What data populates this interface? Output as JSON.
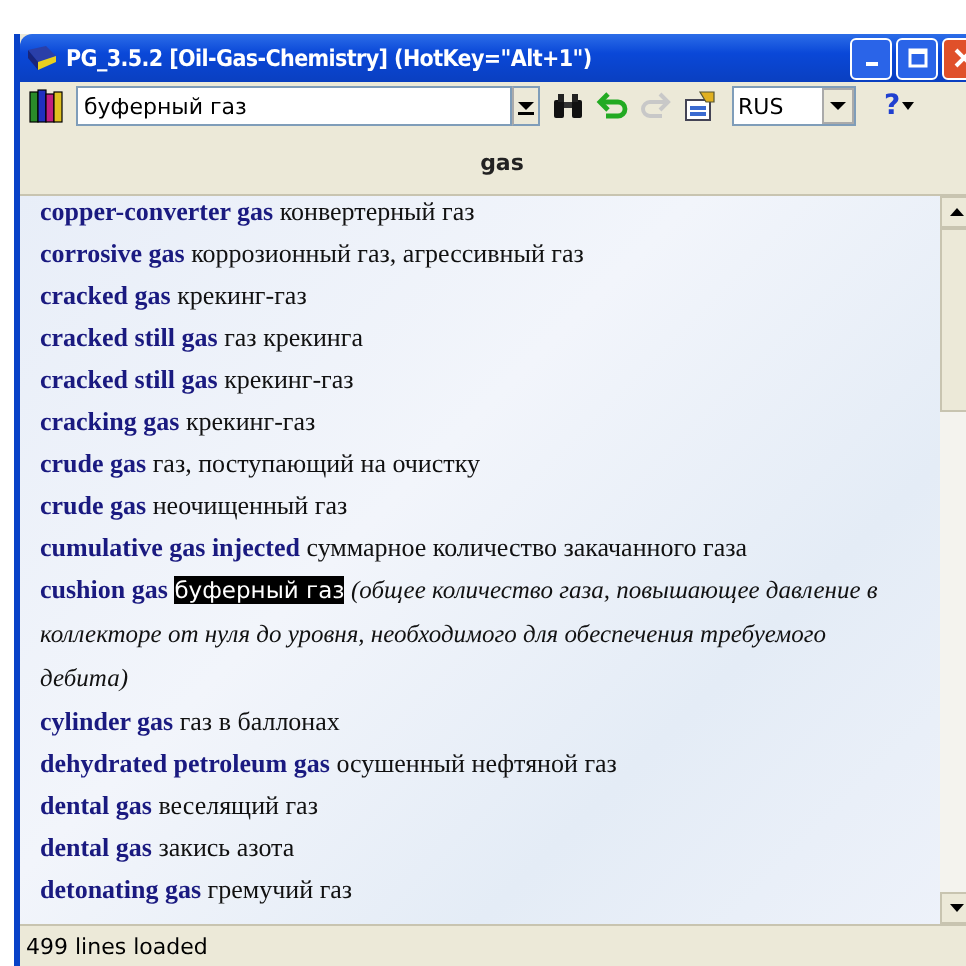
{
  "window": {
    "title": "PG_3.5.2 [Oil-Gas-Chemistry] (HotKey=\"Alt+1\")"
  },
  "toolbar": {
    "search": {
      "value": "буферный газ"
    },
    "forward_disabled": true,
    "language": "RUS",
    "help": "?"
  },
  "header": "gas",
  "entries": [
    {
      "term": "copper-converter gas",
      "translation": "конвертерный газ",
      "selected": false
    },
    {
      "term": "corrosive gas",
      "translation": "коррозионный газ, агрессивный газ",
      "selected": false
    },
    {
      "term": "cracked gas",
      "translation": "крекинг-газ",
      "selected": false
    },
    {
      "term": "cracked still gas",
      "translation": "газ крекинга",
      "selected": false
    },
    {
      "term": "cracked still gas",
      "translation": "крекинг-газ",
      "selected": false
    },
    {
      "term": "cracking gas",
      "translation": "крекинг-газ",
      "selected": false
    },
    {
      "term": "crude gas",
      "translation": "газ, поступающий на очистку",
      "selected": false
    },
    {
      "term": "crude gas",
      "translation": "неочищенный газ",
      "selected": false
    },
    {
      "term": "cumulative gas injected",
      "translation": "суммарное количество закачанного газа",
      "selected": false
    },
    {
      "term": "cushion gas",
      "translation": "буферный газ",
      "note": "(общее количество газа, повышающее давление в коллекторе от нуля до уровня, необходимого для обеспечения требуемого дебита)",
      "selected": true
    },
    {
      "term": "cylinder gas",
      "translation": "газ в баллонах",
      "selected": false
    },
    {
      "term": "dehydrated petroleum gas",
      "translation": "осушенный нефтяной газ",
      "selected": false
    },
    {
      "term": "dental gas",
      "translation": "веселящий газ",
      "selected": false
    },
    {
      "term": "dental gas",
      "translation": "закись азота",
      "selected": false
    },
    {
      "term": "detonating gas",
      "translation": "гремучий газ",
      "selected": false
    }
  ],
  "status_bar": "499 lines loaded"
}
